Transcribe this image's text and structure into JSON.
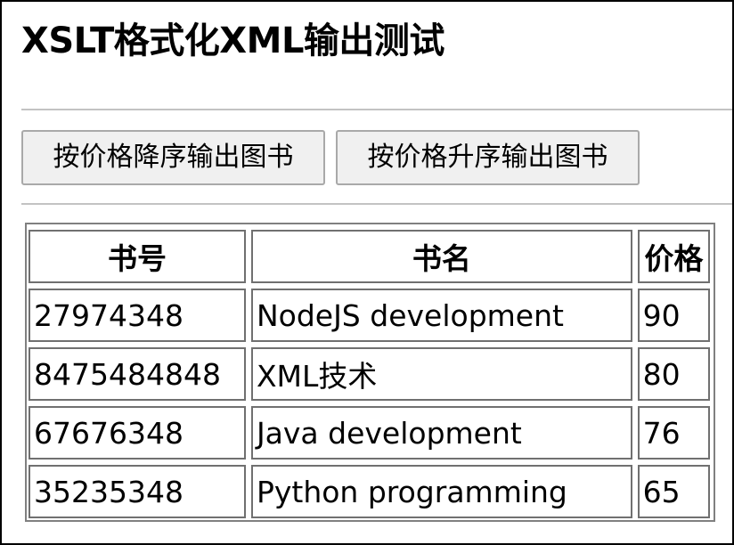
{
  "page": {
    "title": "XSLT格式化XML输出测试"
  },
  "toolbar": {
    "desc_label": "按价格降序输出图书",
    "asc_label": "按价格升序输出图书"
  },
  "table": {
    "headers": {
      "id": "书号",
      "name": "书名",
      "price": "价格"
    },
    "rows": [
      {
        "id": "27974348",
        "name": "NodeJS development",
        "price": "90"
      },
      {
        "id": "8475484848",
        "name": "XML技术",
        "price": "80"
      },
      {
        "id": "67676348",
        "name": "Java development",
        "price": "76"
      },
      {
        "id": "35235348",
        "name": "Python programming",
        "price": "65"
      }
    ]
  }
}
